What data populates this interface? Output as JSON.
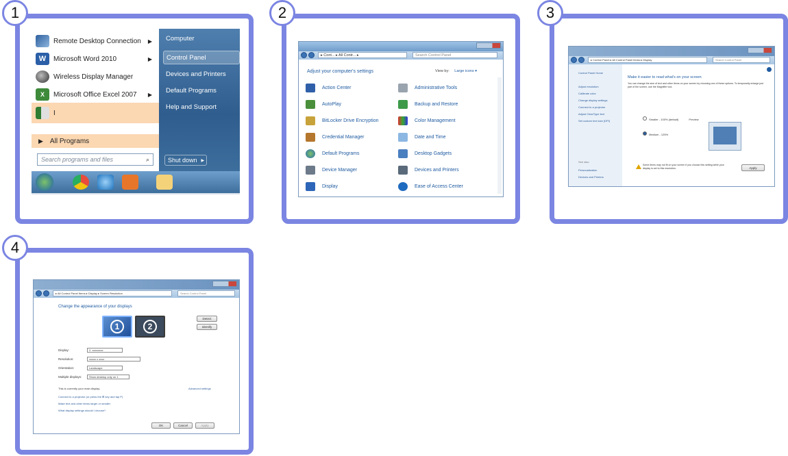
{
  "steps": [
    "1",
    "2",
    "3",
    "4"
  ],
  "start_menu": {
    "programs": [
      {
        "label": "Remote Desktop Connection",
        "icon": "remote-desktop-icon",
        "has_arrow": true
      },
      {
        "label": "Microsoft Word 2010",
        "icon": "word-icon",
        "has_arrow": true
      },
      {
        "label": "Wireless Display Manager",
        "icon": "wireless-display-icon",
        "has_arrow": false
      },
      {
        "label": "Microsoft Office Excel 2007",
        "icon": "excel-icon",
        "has_arrow": true
      },
      {
        "label": "I",
        "icon": "app-icon",
        "has_arrow": false
      }
    ],
    "all_programs": "All Programs",
    "search_placeholder": "Search programs and files",
    "right_items": [
      "Computer",
      "Control Panel",
      "Devices and Printers",
      "Default Programs",
      "Help and Support"
    ],
    "shutdown": "Shut down"
  },
  "control_panel": {
    "address": "▸ Cont... ▸ All Contr... ▸",
    "search": "Search Control Panel",
    "heading": "Adjust your computer's settings",
    "view_by": "View by:",
    "view_value": "Large icons ▾",
    "items_left": [
      "Action Center",
      "AutoPlay",
      "BitLocker Drive Encryption",
      "Credential Manager",
      "Default Programs",
      "Device Manager",
      "Display"
    ],
    "items_right": [
      "Administrative Tools",
      "Backup and Restore",
      "Color Management",
      "Date and Time",
      "Desktop Gadgets",
      "Devices and Printers",
      "Ease of Access Center"
    ]
  },
  "display_window": {
    "address": "▸ Control Panel ▸ All Control Panel Items ▸ Display",
    "search": "Search Control Panel",
    "sidebar": [
      "Control Panel Home",
      "Adjust resolution",
      "Calibrate color",
      "Change display settings",
      "Connect to a projector",
      "Adjust ClearType text",
      "Set custom text size (DPI)"
    ],
    "see_also": "See also",
    "sidebar_bottom": [
      "Personalization",
      "Devices and Printers"
    ],
    "title": "Make it easier to read what's on your screen",
    "description": "You can change the size of text and other items on your screen by choosing one of these options. To temporarily enlarge just part of the screen, use the Magnifier tool.",
    "option_small": "Smaller - 100% (default)",
    "preview": "Preview",
    "option_medium": "Medium - 125%",
    "warning": "Some items may not fit on your screen if you choose this setting while your display is set to this resolution.",
    "apply": "Apply"
  },
  "resolution_window": {
    "address": "▸ All Control Panel Items ▸ Display ▸ Screen Resolution",
    "search": "Search Control Panel",
    "title": "Change the appearance of your displays",
    "monitor_1": "1",
    "monitor_2": "2",
    "detect": "Detect",
    "identify": "Identify",
    "labels": [
      "Display:",
      "Resolution:",
      "Orientation:",
      "Multiple displays:"
    ],
    "values": [
      "2. xxxxxxxx",
      "xxxxx x xxxx",
      "Landscape",
      "Show desktop only on 1"
    ],
    "current_note": "This is currently your main display.",
    "advanced": "Advanced settings",
    "links": [
      "Connect to a projector (or press the ⊞ key and tap P)",
      "Make text and other items larger or smaller",
      "What display settings should I choose?"
    ],
    "ok": "OK",
    "cancel": "Cancel",
    "apply": "Apply"
  },
  "colors": {
    "frame": "#7b85e2",
    "link": "#1e5aa0"
  }
}
